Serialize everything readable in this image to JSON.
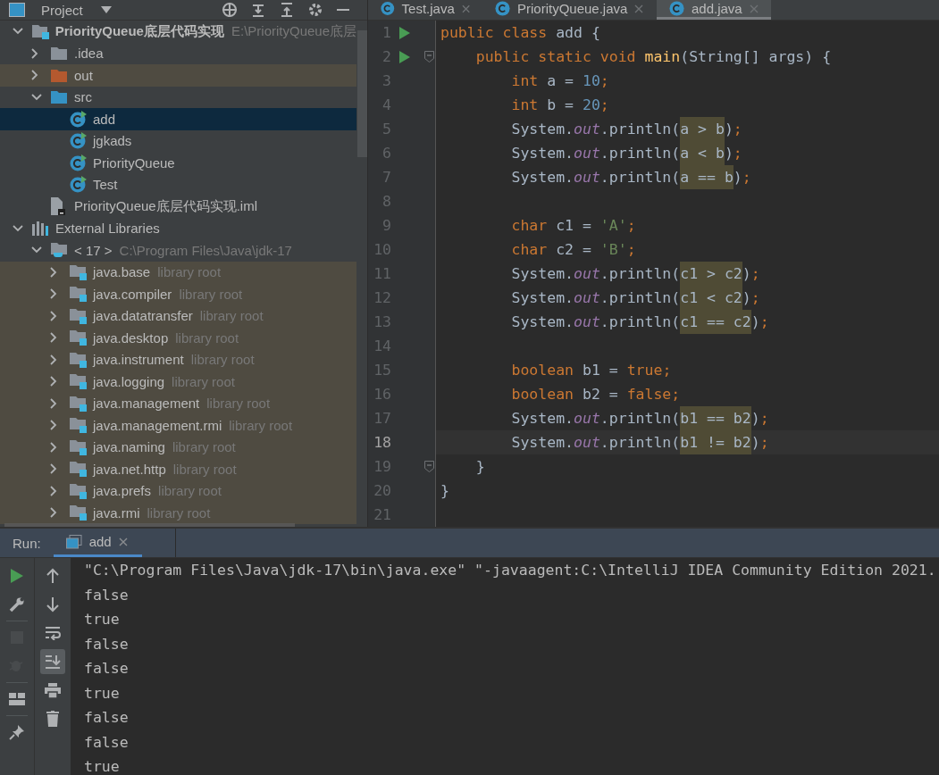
{
  "project_panel": {
    "title": "Project",
    "tree": [
      {
        "label": "PriorityQueue底层代码实现",
        "hint": "E:\\PriorityQueue底层",
        "kind": "project",
        "expanded": true,
        "selected": false,
        "tinted": false,
        "children": [
          {
            "label": ".idea",
            "kind": "folder",
            "expanded": false,
            "selected": false,
            "tinted": false
          },
          {
            "label": "out",
            "kind": "folder-excluded",
            "expanded": false,
            "selected": false,
            "tinted": true
          },
          {
            "label": "src",
            "kind": "folder-source",
            "expanded": true,
            "selected": false,
            "tinted": false,
            "children": [
              {
                "label": "add",
                "kind": "class",
                "selected": true,
                "tinted": false
              },
              {
                "label": "jgkads",
                "kind": "class",
                "selected": false,
                "tinted": false
              },
              {
                "label": "PriorityQueue",
                "kind": "class",
                "selected": false,
                "tinted": false
              },
              {
                "label": "Test",
                "kind": "class",
                "selected": false,
                "tinted": false
              }
            ]
          },
          {
            "label": "PriorityQueue底层代码实现.iml",
            "kind": "file",
            "selected": false,
            "tinted": false
          }
        ]
      },
      {
        "label": "External Libraries",
        "kind": "libraries",
        "expanded": true,
        "selected": false,
        "tinted": false,
        "children": [
          {
            "label": "< 17 >",
            "hint": "C:\\Program Files\\Java\\jdk-17",
            "kind": "jdk",
            "expanded": true,
            "selected": false,
            "tinted": false,
            "children": [
              {
                "label": "java.base",
                "hint": "library root",
                "kind": "library",
                "expanded": false,
                "selected": false,
                "tinted": true
              },
              {
                "label": "java.compiler",
                "hint": "library root",
                "kind": "library",
                "expanded": false,
                "selected": false,
                "tinted": true
              },
              {
                "label": "java.datatransfer",
                "hint": "library root",
                "kind": "library",
                "expanded": false,
                "selected": false,
                "tinted": true
              },
              {
                "label": "java.desktop",
                "hint": "library root",
                "kind": "library",
                "expanded": false,
                "selected": false,
                "tinted": true
              },
              {
                "label": "java.instrument",
                "hint": "library root",
                "kind": "library",
                "expanded": false,
                "selected": false,
                "tinted": true
              },
              {
                "label": "java.logging",
                "hint": "library root",
                "kind": "library",
                "expanded": false,
                "selected": false,
                "tinted": true
              },
              {
                "label": "java.management",
                "hint": "library root",
                "kind": "library",
                "expanded": false,
                "selected": false,
                "tinted": true
              },
              {
                "label": "java.management.rmi",
                "hint": "library root",
                "kind": "library",
                "expanded": false,
                "selected": false,
                "tinted": true
              },
              {
                "label": "java.naming",
                "hint": "library root",
                "kind": "library",
                "expanded": false,
                "selected": false,
                "tinted": true
              },
              {
                "label": "java.net.http",
                "hint": "library root",
                "kind": "library",
                "expanded": false,
                "selected": false,
                "tinted": true
              },
              {
                "label": "java.prefs",
                "hint": "library root",
                "kind": "library",
                "expanded": false,
                "selected": false,
                "tinted": true
              },
              {
                "label": "java.rmi",
                "hint": "library root",
                "kind": "library",
                "expanded": false,
                "selected": false,
                "tinted": true
              }
            ]
          }
        ]
      }
    ]
  },
  "editor": {
    "tabs": [
      {
        "label": "Test.java",
        "selected": false
      },
      {
        "label": "PriorityQueue.java",
        "selected": false
      },
      {
        "label": "add.java",
        "selected": true
      }
    ],
    "lines": [
      {
        "number": "1",
        "run": true,
        "fold": false,
        "current": false,
        "tokens": [
          {
            "text": "public class ",
            "kind": "kw"
          },
          {
            "text": "add {",
            "kind": "plain"
          }
        ]
      },
      {
        "number": "2",
        "run": true,
        "fold": true,
        "current": false,
        "tokens": [
          {
            "text": "    public static void ",
            "kind": "kw"
          },
          {
            "text": "main",
            "kind": "fn"
          },
          {
            "text": "(String[] args) {",
            "kind": "plain"
          }
        ]
      },
      {
        "number": "3",
        "run": false,
        "fold": false,
        "current": false,
        "tokens": [
          {
            "text": "        int ",
            "kind": "kw"
          },
          {
            "text": "a = ",
            "kind": "plain"
          },
          {
            "text": "10",
            "kind": "num"
          },
          {
            "text": ";",
            "kind": "kw"
          }
        ]
      },
      {
        "number": "4",
        "run": false,
        "fold": false,
        "current": false,
        "tokens": [
          {
            "text": "        int ",
            "kind": "kw"
          },
          {
            "text": "b = ",
            "kind": "plain"
          },
          {
            "text": "20",
            "kind": "num"
          },
          {
            "text": ";",
            "kind": "kw"
          }
        ]
      },
      {
        "number": "5",
        "run": false,
        "fold": false,
        "current": false,
        "tokens": [
          {
            "text": "        System.",
            "kind": "plain"
          },
          {
            "text": "out",
            "kind": "field"
          },
          {
            "text": ".println(",
            "kind": "plain"
          },
          {
            "text": "a > b",
            "kind": "match"
          },
          {
            "text": ")",
            "kind": "plain"
          },
          {
            "text": ";",
            "kind": "kw"
          }
        ]
      },
      {
        "number": "6",
        "run": false,
        "fold": false,
        "current": false,
        "tokens": [
          {
            "text": "        System.",
            "kind": "plain"
          },
          {
            "text": "out",
            "kind": "field"
          },
          {
            "text": ".println(",
            "kind": "plain"
          },
          {
            "text": "a < b",
            "kind": "match"
          },
          {
            "text": ")",
            "kind": "plain"
          },
          {
            "text": ";",
            "kind": "kw"
          }
        ]
      },
      {
        "number": "7",
        "run": false,
        "fold": false,
        "current": false,
        "tokens": [
          {
            "text": "        System.",
            "kind": "plain"
          },
          {
            "text": "out",
            "kind": "field"
          },
          {
            "text": ".println(",
            "kind": "plain"
          },
          {
            "text": "a == b",
            "kind": "match"
          },
          {
            "text": ")",
            "kind": "plain"
          },
          {
            "text": ";",
            "kind": "kw"
          }
        ]
      },
      {
        "number": "8",
        "run": false,
        "fold": false,
        "current": false
      },
      {
        "number": "9",
        "run": false,
        "fold": false,
        "current": false,
        "tokens": [
          {
            "text": "        char ",
            "kind": "kw"
          },
          {
            "text": "c1 = ",
            "kind": "plain"
          },
          {
            "text": "'A'",
            "kind": "str"
          },
          {
            "text": ";",
            "kind": "kw"
          }
        ]
      },
      {
        "number": "10",
        "run": false,
        "fold": false,
        "current": false,
        "tokens": [
          {
            "text": "        char ",
            "kind": "kw"
          },
          {
            "text": "c2 = ",
            "kind": "plain"
          },
          {
            "text": "'B'",
            "kind": "str"
          },
          {
            "text": ";",
            "kind": "kw"
          }
        ]
      },
      {
        "number": "11",
        "run": false,
        "fold": false,
        "current": false,
        "tokens": [
          {
            "text": "        System.",
            "kind": "plain"
          },
          {
            "text": "out",
            "kind": "field"
          },
          {
            "text": ".println(",
            "kind": "plain"
          },
          {
            "text": "c1 > c2",
            "kind": "match"
          },
          {
            "text": ")",
            "kind": "plain"
          },
          {
            "text": ";",
            "kind": "kw"
          }
        ]
      },
      {
        "number": "12",
        "run": false,
        "fold": false,
        "current": false,
        "tokens": [
          {
            "text": "        System.",
            "kind": "plain"
          },
          {
            "text": "out",
            "kind": "field"
          },
          {
            "text": ".println(",
            "kind": "plain"
          },
          {
            "text": "c1 < c2",
            "kind": "match"
          },
          {
            "text": ")",
            "kind": "plain"
          },
          {
            "text": ";",
            "kind": "kw"
          }
        ]
      },
      {
        "number": "13",
        "run": false,
        "fold": false,
        "current": false,
        "tokens": [
          {
            "text": "        System.",
            "kind": "plain"
          },
          {
            "text": "out",
            "kind": "field"
          },
          {
            "text": ".println(",
            "kind": "plain"
          },
          {
            "text": "c1 == c2",
            "kind": "match"
          },
          {
            "text": ")",
            "kind": "plain"
          },
          {
            "text": ";",
            "kind": "kw"
          }
        ]
      },
      {
        "number": "14",
        "run": false,
        "fold": false,
        "current": false
      },
      {
        "number": "15",
        "run": false,
        "fold": false,
        "current": false,
        "tokens": [
          {
            "text": "        boolean ",
            "kind": "kw"
          },
          {
            "text": "b1 = ",
            "kind": "plain"
          },
          {
            "text": "true",
            "kind": "kw"
          },
          {
            "text": ";",
            "kind": "kw"
          }
        ]
      },
      {
        "number": "16",
        "run": false,
        "fold": false,
        "current": false,
        "tokens": [
          {
            "text": "        boolean ",
            "kind": "kw"
          },
          {
            "text": "b2 = ",
            "kind": "plain"
          },
          {
            "text": "false",
            "kind": "kw"
          },
          {
            "text": ";",
            "kind": "kw"
          }
        ]
      },
      {
        "number": "17",
        "run": false,
        "fold": false,
        "current": false,
        "tokens": [
          {
            "text": "        System.",
            "kind": "plain"
          },
          {
            "text": "out",
            "kind": "field"
          },
          {
            "text": ".println(",
            "kind": "plain"
          },
          {
            "text": "b1 == b2",
            "kind": "match"
          },
          {
            "text": ")",
            "kind": "plain"
          },
          {
            "text": ";",
            "kind": "kw"
          }
        ]
      },
      {
        "number": "18",
        "run": false,
        "fold": false,
        "current": true,
        "tokens": [
          {
            "text": "        System.",
            "kind": "plain"
          },
          {
            "text": "out",
            "kind": "field"
          },
          {
            "text": ".println(",
            "kind": "plain"
          },
          {
            "text": "b1 != b2",
            "kind": "match"
          },
          {
            "text": ")",
            "kind": "plain"
          },
          {
            "text": ";",
            "kind": "kw"
          }
        ]
      },
      {
        "number": "19",
        "run": false,
        "fold": true,
        "current": false,
        "tokens": [
          {
            "text": "    }",
            "kind": "plain"
          }
        ]
      },
      {
        "number": "20",
        "run": false,
        "fold": false,
        "current": false,
        "tokens": [
          {
            "text": "}",
            "kind": "plain"
          }
        ]
      },
      {
        "number": "21",
        "run": false,
        "fold": false,
        "current": false
      }
    ]
  },
  "run_panel": {
    "title": "Run:",
    "tabs": [
      {
        "label": "add",
        "selected": true
      }
    ],
    "left_toolbar": [
      {
        "kind": "run",
        "disabled": false
      },
      {
        "kind": "wrench",
        "disabled": false
      },
      {
        "kind": "stop",
        "disabled": true
      },
      {
        "kind": "debug",
        "disabled": true
      },
      {
        "kind": "layout",
        "disabled": false
      },
      {
        "kind": "pin",
        "disabled": false
      }
    ],
    "right_toolbar": [
      {
        "kind": "up",
        "on": false
      },
      {
        "kind": "down",
        "on": false
      },
      {
        "kind": "wrap",
        "on": false
      },
      {
        "kind": "scroll-end",
        "on": true
      },
      {
        "kind": "print",
        "on": false
      },
      {
        "kind": "trash",
        "on": false
      }
    ],
    "console": [
      "\"C:\\Program Files\\Java\\jdk-17\\bin\\java.exe\" \"-javaagent:C:\\IntelliJ IDEA Community Edition 2021.",
      "false",
      "true",
      "false",
      "false",
      "true",
      "false",
      "false",
      "true"
    ]
  }
}
